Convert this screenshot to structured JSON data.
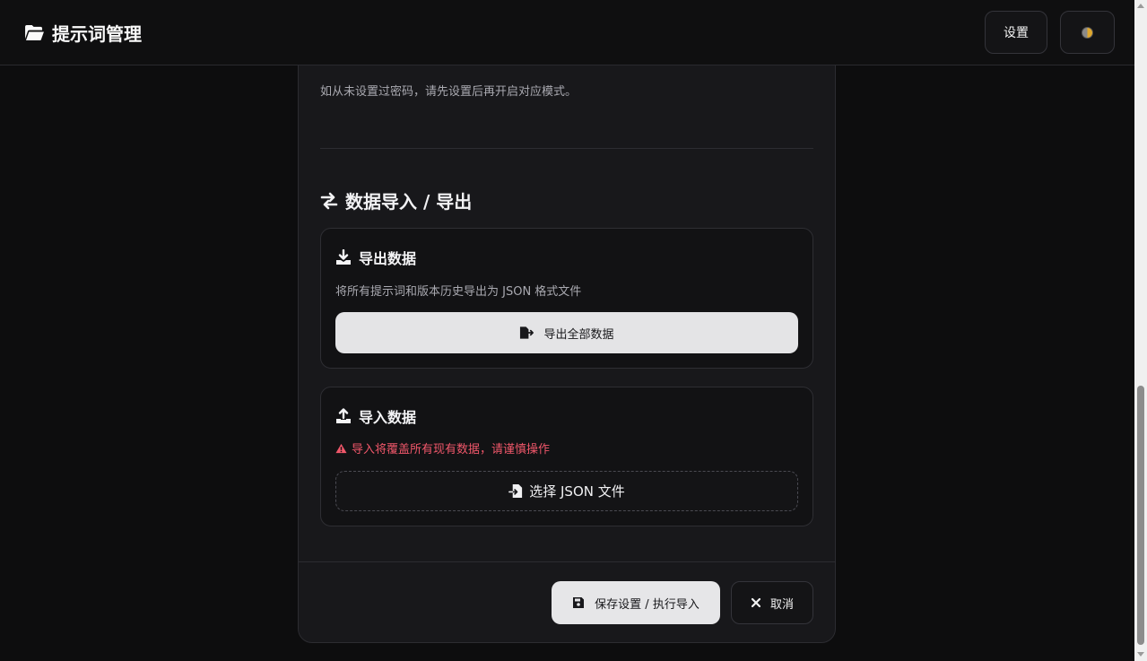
{
  "header": {
    "title": "提示词管理",
    "settings_label": "设置",
    "theme_icon": "half-circle-icon"
  },
  "modal": {
    "password_hint": "如从未设置过密码，请先设置后再开启对应模式。",
    "section_title": "数据导入 / 导出",
    "export": {
      "title": "导出数据",
      "description": "将所有提示词和版本历史导出为 JSON 格式文件",
      "button_label": "导出全部数据"
    },
    "import": {
      "title": "导入数据",
      "warning": "导入将覆盖所有现有数据，请谨慎操作",
      "file_button_label": "选择 JSON 文件"
    },
    "footer": {
      "save_label": "保存设置 / 执行导入",
      "cancel_label": "取消"
    }
  },
  "colors": {
    "background": "#0d0d0e",
    "panel": "#18181b",
    "warning": "#f0576a",
    "primary_button": "#e4e4e6"
  }
}
